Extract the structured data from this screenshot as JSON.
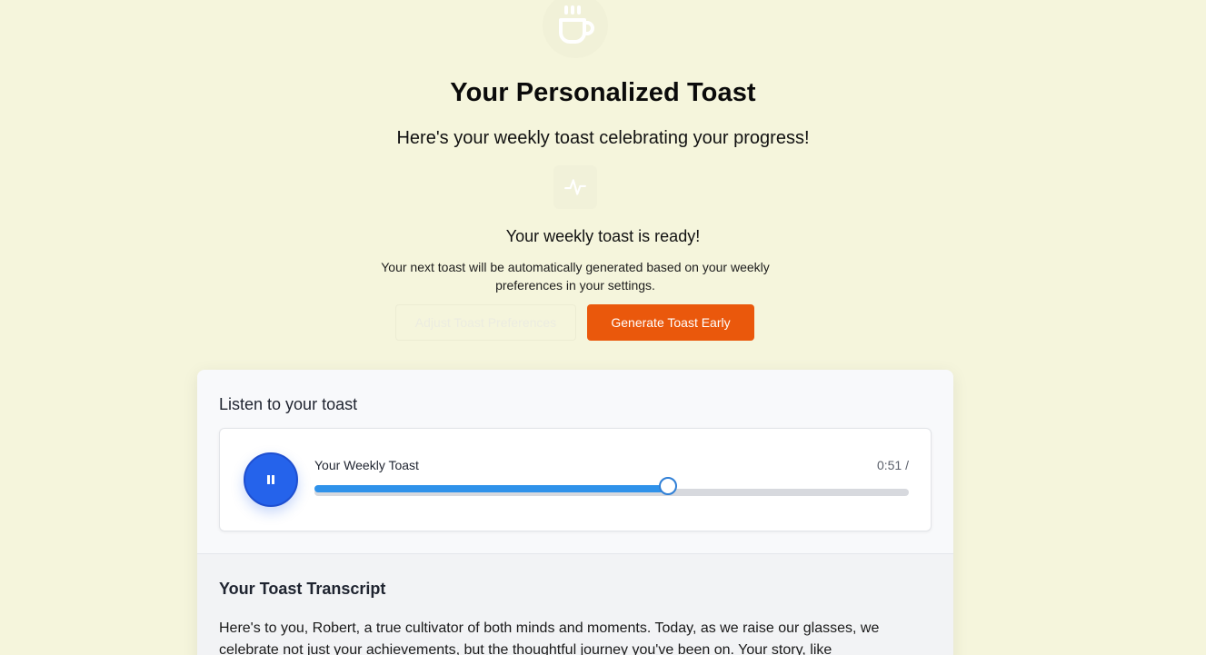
{
  "header": {
    "hero_icon": "coffee-cup-icon",
    "title": "Your Personalized Toast",
    "subtitle": "Here's your weekly toast celebrating your progress!",
    "status_icon": "activity-pulse-icon"
  },
  "status": {
    "ready": "Your weekly toast is ready!",
    "note": "Your next toast will be automatically generated based on your weekly preferences in your settings."
  },
  "actions": {
    "adjust_label": "Adjust Toast Preferences",
    "generate_label": "Generate Toast Early"
  },
  "player": {
    "heading": "Listen to your toast",
    "state": "playing",
    "button_icon": "pause-icon",
    "track_title": "Your Weekly Toast",
    "time": "0:51 /",
    "progress": 0.595
  },
  "transcript": {
    "heading": "Your Toast Transcript",
    "body": "Here's to you, Robert, a true cultivator of both minds and moments. Today, as we raise our glasses, we celebrate not just your achievements, but the thoughtful journey you've been on. Your story, like"
  },
  "colors": {
    "background": "#f5f5dc",
    "accent_orange": "#ea580c",
    "accent_blue": "#2563eb",
    "progress_blue": "#2f92ea"
  }
}
